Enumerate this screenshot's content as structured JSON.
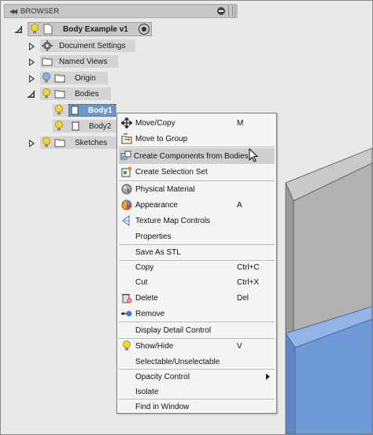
{
  "browser": {
    "title": "BROWSER",
    "root": {
      "label": "Body Example v1"
    },
    "nodes": [
      {
        "label": "Document Settings"
      },
      {
        "label": "Named Views"
      },
      {
        "label": "Origin"
      },
      {
        "label": "Bodies"
      },
      {
        "label": "Body1"
      },
      {
        "label": "Body2"
      },
      {
        "label": "Sketches"
      }
    ]
  },
  "menu": {
    "items": [
      {
        "label": "Move/Copy",
        "shortcut": "M",
        "icon": "move-icon"
      },
      {
        "label": "Move to Group",
        "shortcut": "",
        "icon": "move-to-group-icon"
      },
      {
        "label": "Create Components from Bodies",
        "shortcut": "",
        "icon": "create-components-icon"
      },
      {
        "label": "Create Selection Set",
        "shortcut": "",
        "icon": "selection-set-icon"
      },
      {
        "label": "Physical Material",
        "shortcut": "",
        "icon": "physical-material-icon"
      },
      {
        "label": "Appearance",
        "shortcut": "A",
        "icon": "appearance-icon"
      },
      {
        "label": "Texture Map Controls",
        "shortcut": "",
        "icon": "texture-map-icon"
      },
      {
        "label": "Properties",
        "shortcut": "",
        "icon": ""
      },
      {
        "label": "Save As STL",
        "shortcut": "",
        "icon": ""
      },
      {
        "label": "Copy",
        "shortcut": "Ctrl+C",
        "icon": ""
      },
      {
        "label": "Cut",
        "shortcut": "Ctrl+X",
        "icon": ""
      },
      {
        "label": "Delete",
        "shortcut": "Del",
        "icon": "delete-icon"
      },
      {
        "label": "Remove",
        "shortcut": "",
        "icon": "remove-icon"
      },
      {
        "label": "Display Detail Control",
        "shortcut": "",
        "icon": ""
      },
      {
        "label": "Show/Hide",
        "shortcut": "V",
        "icon": "bulb-icon"
      },
      {
        "label": "Selectable/Unselectable",
        "shortcut": "",
        "icon": ""
      },
      {
        "label": "Opacity Control",
        "shortcut": "",
        "icon": ""
      },
      {
        "label": "Isolate",
        "shortcut": "",
        "icon": ""
      },
      {
        "label": "Find in Window",
        "shortcut": "",
        "icon": ""
      }
    ]
  },
  "colors": {
    "selection": "#6c97c9",
    "hover": "#cfcfcf",
    "gray_box": "#b0b0b0",
    "blue_box": "#6f9ad8"
  }
}
